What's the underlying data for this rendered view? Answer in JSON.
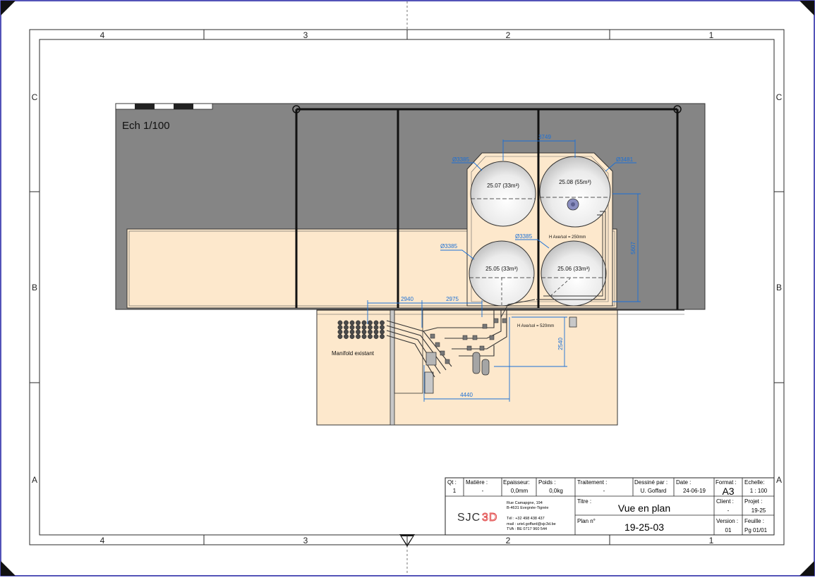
{
  "colors": {
    "building": "#858585",
    "concrete": "#fde8cc",
    "dimension": "#1a6fd6",
    "frame": "#2a2a2a",
    "sheet_border": "#1a1aa0"
  },
  "frame": {
    "columns_top": [
      "4",
      "3",
      "2",
      "1"
    ],
    "columns_bottom": [
      "4",
      "3",
      "2",
      "1"
    ],
    "rows_left": [
      "C",
      "B",
      "A"
    ],
    "rows_right": [
      "C",
      "B",
      "A"
    ]
  },
  "drawing": {
    "scale_label": "Ech 1/100",
    "manifold_label": "Manifold existant",
    "tanks": [
      {
        "label": "25.07 (33m³)",
        "diameter": "Ø3385"
      },
      {
        "label": "25.08 (55m³)",
        "diameter": "Ø3481"
      },
      {
        "label": "25.05 (33m³)",
        "diameter": "Ø3385"
      },
      {
        "label": "25.06 (33m³)",
        "diameter": "Ø3385"
      }
    ],
    "dimensions": {
      "top_width": "3749",
      "right_height": "5607",
      "left_offset_1": "2940",
      "left_offset_2": "2975",
      "bottom_width": "4440",
      "equipment_height": "2540"
    },
    "notes": {
      "axis_height_upper": "H Axe/sol = 250mm",
      "axis_height_lower": "H Axe/sol = 520mm"
    }
  },
  "title_block": {
    "qty_label": "Qt :",
    "qty_value": "1",
    "material_label": "Matière :",
    "material_value": "-",
    "thickness_label": "Epaisseur:",
    "thickness_value": "0,0mm",
    "weight_label": "Poids :",
    "weight_value": "0,0kg",
    "treatment_label": "Traitement :",
    "treatment_value": "-",
    "drawn_by_label": "Dessiné par :",
    "drawn_by_value": "U. Goffard",
    "date_label": "Date :",
    "date_value": "24-06-19",
    "format_label": "Format :",
    "format_value": "A3",
    "scale_label": "Echelle:",
    "scale_value": "1 : 100",
    "logo_sjc": "SJC",
    "logo_3d": "3D",
    "address_line1": "Rue Camapgne, 194",
    "address_line2": "B-4631 Evegnée-Tignée",
    "phone": "Tél : +32 498 438 437",
    "email": "mail : uriel.goffard@sjc3d.be",
    "vat": "TVA : BE 0717 960 544",
    "title_label": "Titre :",
    "title_value": "Vue en plan",
    "client_label": "Client :",
    "client_value": "-",
    "project_label": "Projet :",
    "project_value": "19-25",
    "plan_label": "Plan n°",
    "plan_value": "19-25-03",
    "version_label": "Version :",
    "version_value": "01",
    "sheet_label": "Feuille :",
    "sheet_value": "Pg  01/01"
  }
}
